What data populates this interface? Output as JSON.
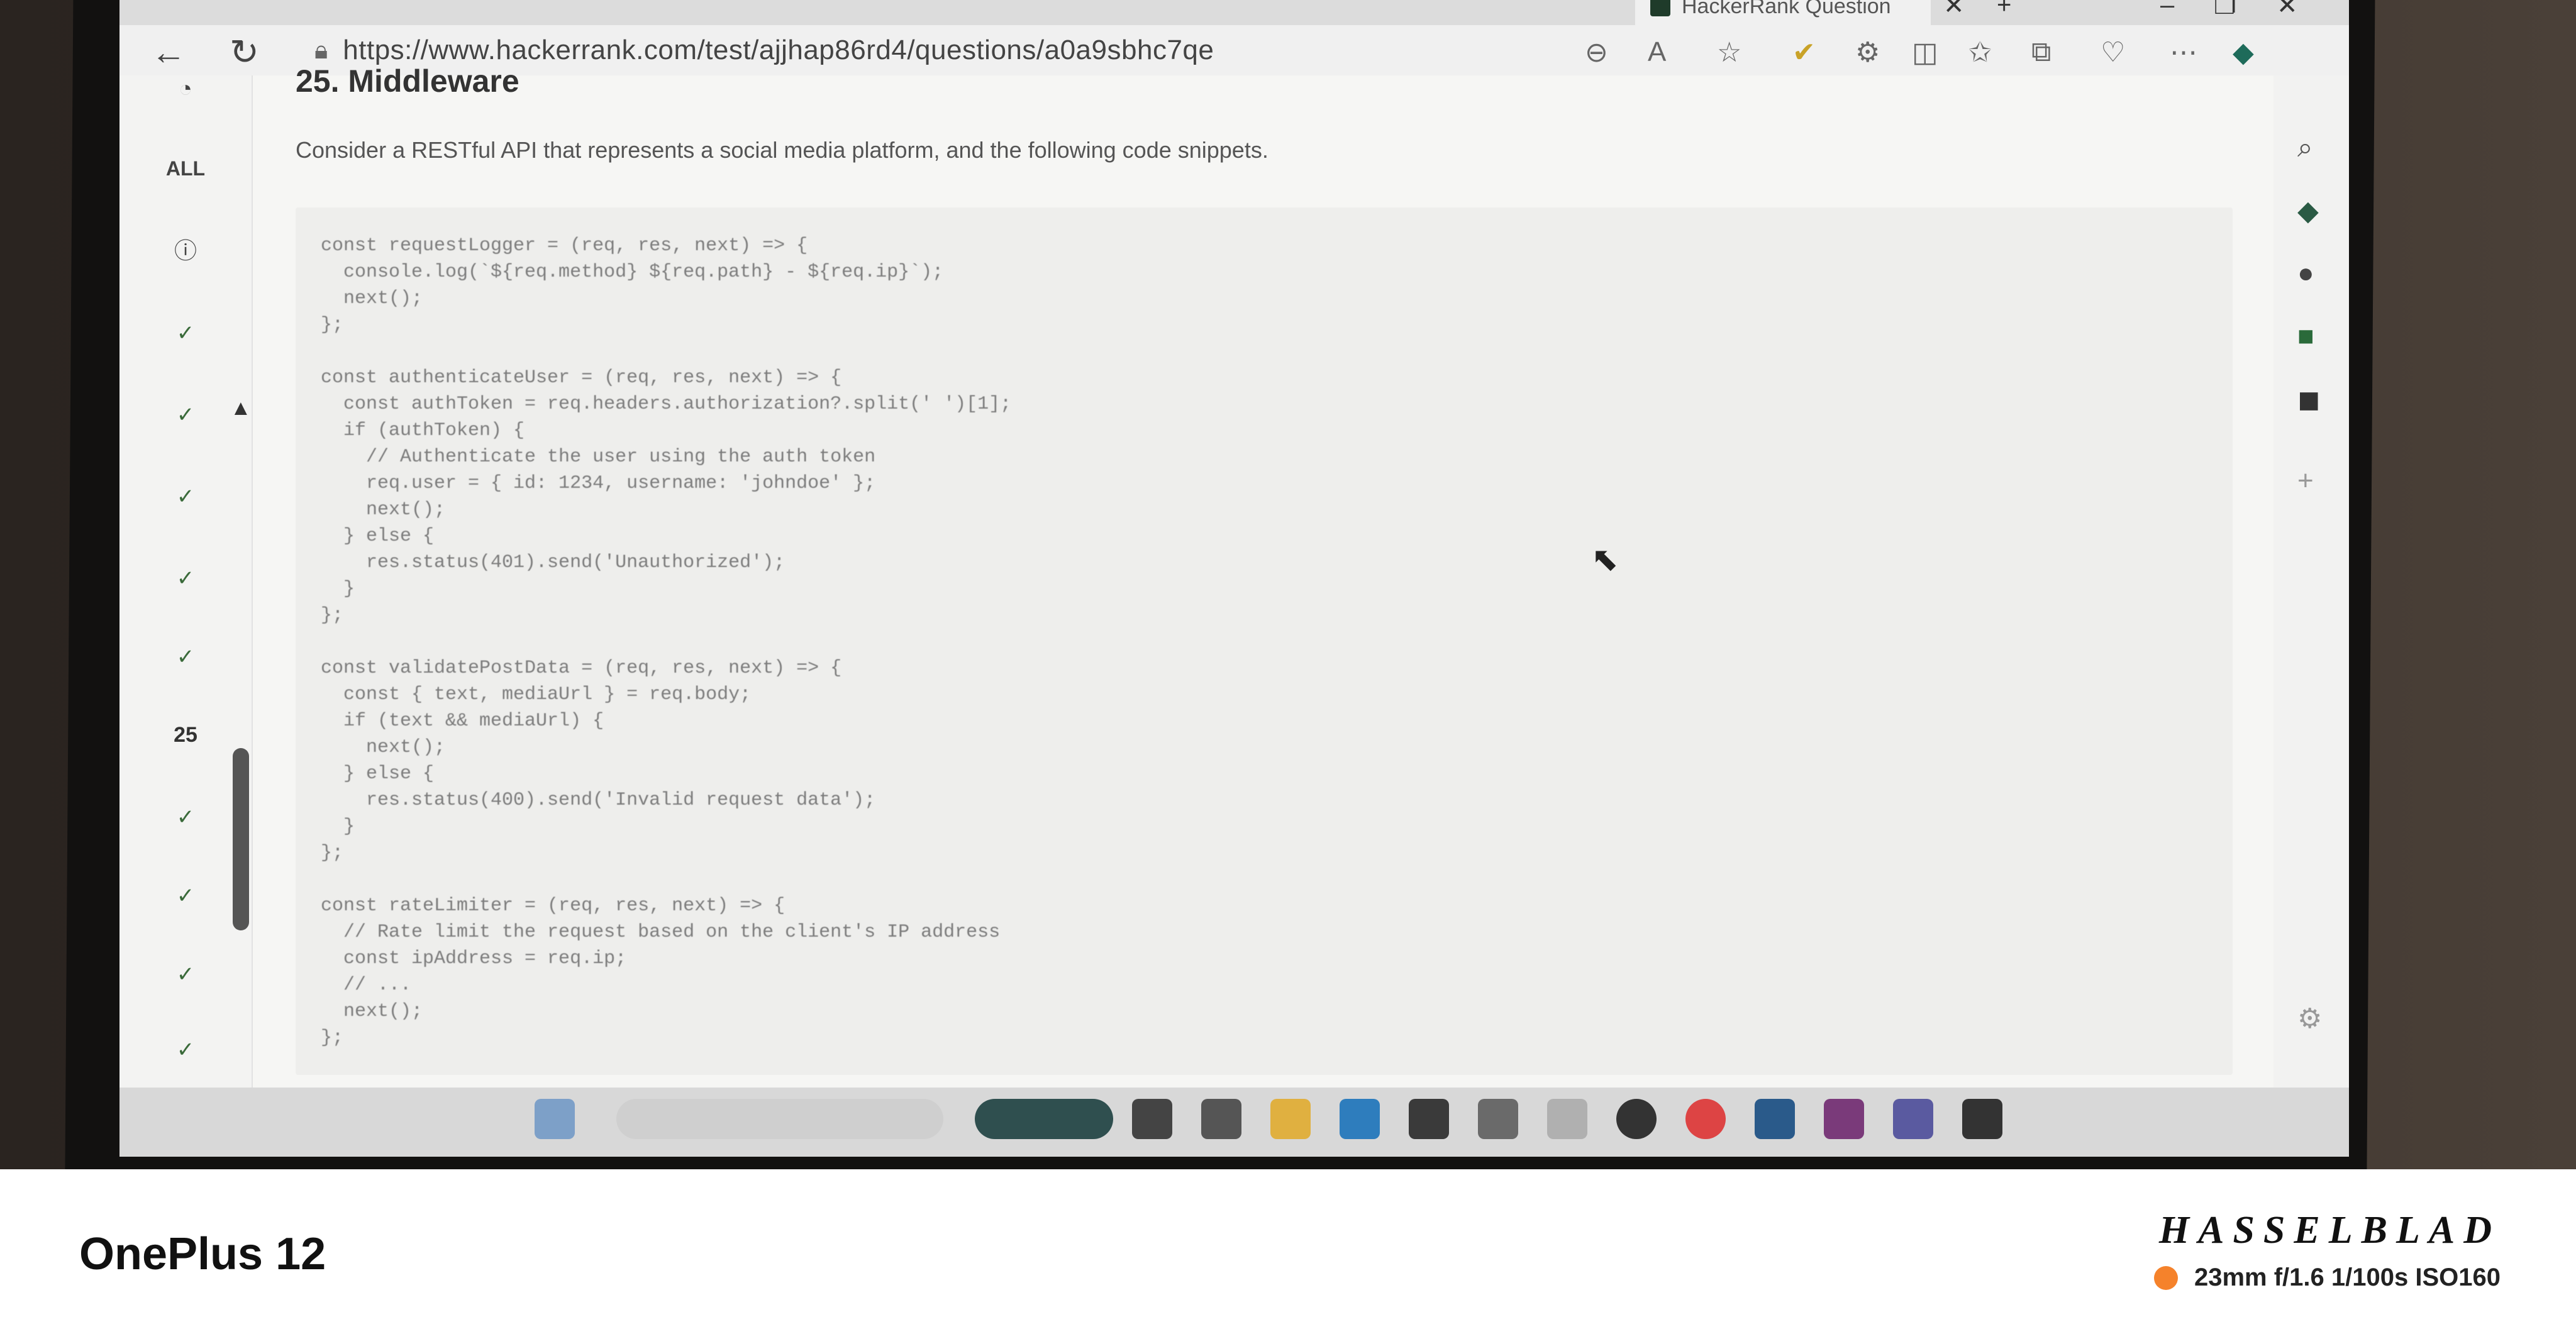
{
  "browser": {
    "active_tab_title": "HackerRank Question - Middlew",
    "url": "https://www.hackerrank.com/test/ajjhap86rd4/questions/a0a9sbhc7qe"
  },
  "sidebar": {
    "all_label": "ALL",
    "current_question": "25"
  },
  "question": {
    "title": "25. Middleware",
    "text": "Consider a RESTful API that represents a social media platform, and the following code snippets.",
    "code": "const requestLogger = (req, res, next) => {\n  console.log(`${req.method} ${req.path} - ${req.ip}`);\n  next();\n};\n\nconst authenticateUser = (req, res, next) => {\n  const authToken = req.headers.authorization?.split(' ')[1];\n  if (authToken) {\n    // Authenticate the user using the auth token\n    req.user = { id: 1234, username: 'johndoe' };\n    next();\n  } else {\n    res.status(401).send('Unauthorized');\n  }\n};\n\nconst validatePostData = (req, res, next) => {\n  const { text, mediaUrl } = req.body;\n  if (text && mediaUrl) {\n    next();\n  } else {\n    res.status(400).send('Invalid request data');\n  }\n};\n\nconst rateLimiter = (req, res, next) => {\n  // Rate limit the request based on the client's IP address\n  const ipAddress = req.ip;\n  // ...\n  next();\n};"
  },
  "caption": {
    "device": "OnePlus 12",
    "brand": "HASSELBLAD",
    "specs": "23mm  f/1.6  1/100s  ISO160",
    "accent_color": "#f5822b"
  }
}
